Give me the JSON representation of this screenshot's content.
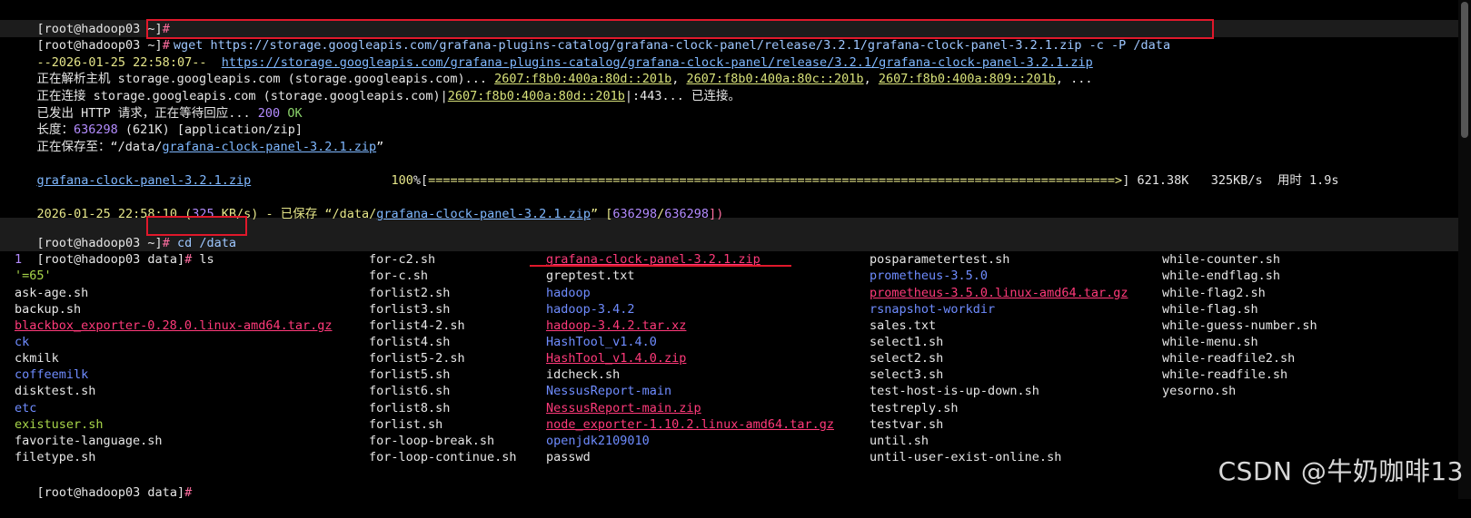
{
  "lines": {
    "l0": {
      "prompt": "[root@hadoop03 ~]",
      "hash": "#"
    },
    "l1": {
      "prompt": "[root@hadoop03 ~]",
      "hash": "#",
      "cmd": "wget https://storage.googleapis.com/grafana-plugins-catalog/grafana-clock-panel/release/3.2.1/grafana-clock-panel-3.2.1.zip -c -P /data"
    },
    "l2": {
      "ts": "--2026-01-25 22:58:07--",
      "url": "https://storage.googleapis.com/grafana-plugins-catalog/grafana-clock-panel/release/3.2.1/grafana-clock-panel-3.2.1.zip"
    },
    "l3": {
      "text1": "正在解析主机 storage.googleapis.com (storage.googleapis.com)... ",
      "ip1": "2607:f8b0:400a:80d::201b",
      "sep1": ", ",
      "ip2": "2607:f8b0:400a:80c::201b",
      "sep2": ", ",
      "ip3": "2607:f8b0:400a:809::201b",
      "tail": ", ..."
    },
    "l4": {
      "text1": "正在连接 storage.googleapis.com (storage.googleapis.com)|",
      "ip": "2607:f8b0:400a:80d::201b",
      "text2": "|:443... 已连接。"
    },
    "l5": {
      "text1": "已发出 HTTP 请求，正在等待回应... ",
      "code": "200",
      "ok": " OK"
    },
    "l6": {
      "label": "长度：",
      "len": "636298",
      "size": " (621K) ",
      "type": "[application/zip]"
    },
    "l7": {
      "label": "正在保存至：“/data/",
      "file": "grafana-clock-panel-3.2.1.zip",
      "end": "”"
    },
    "l9": {
      "file": "grafana-clock-panel-3.2.1.zip",
      "pct": "100",
      "pctsym": "%[",
      "bar": "=============================================================================================>",
      "close": "]",
      "stats": " 621.38K   325KB/s  用时 1.9s"
    },
    "l11": {
      "ts": "2026-01-25 22:58:10 (",
      "rate": "325",
      "rate2": " KB/s) - 已保存 “/data/",
      "file": "grafana-clock-panel-3.2.1.zip",
      "q": "” [",
      "n1": "636298",
      "slash": "/",
      "n2": "636298",
      "end": "])"
    },
    "l13": {
      "prompt": "[root@hadoop03 ~]",
      "hash": "#",
      "cmd": " cd /data"
    },
    "l14": {
      "prompt": "[root@hadoop03 data]",
      "hash": "#",
      "cmd": " ls"
    },
    "l26": {
      "prompt": "[root@hadoop03 data]",
      "hash": "#"
    }
  },
  "ls": {
    "col1": [
      {
        "name": "1",
        "kind": "num"
      },
      {
        "name": "'=65'",
        "kind": "exec"
      },
      {
        "name": "ask-age.sh",
        "kind": "plain"
      },
      {
        "name": "backup.sh",
        "kind": "plain"
      },
      {
        "name": "blackbox_exporter-0.28.0.linux-amd64.tar.gz",
        "kind": "zip"
      },
      {
        "name": "ck",
        "kind": "dir"
      },
      {
        "name": "ckmilk",
        "kind": "plain"
      },
      {
        "name": "coffeemilk",
        "kind": "dir"
      },
      {
        "name": "disktest.sh",
        "kind": "plain"
      },
      {
        "name": "etc",
        "kind": "dir"
      },
      {
        "name": "existuser.sh",
        "kind": "exec"
      },
      {
        "name": "favorite-language.sh",
        "kind": "plain"
      },
      {
        "name": "filetype.sh",
        "kind": "plain"
      }
    ],
    "col2": [
      {
        "name": "for-c2.sh",
        "kind": "plain"
      },
      {
        "name": "for-c.sh",
        "kind": "plain"
      },
      {
        "name": "forlist2.sh",
        "kind": "plain"
      },
      {
        "name": "forlist3.sh",
        "kind": "plain"
      },
      {
        "name": "forlist4-2.sh",
        "kind": "plain"
      },
      {
        "name": "forlist4.sh",
        "kind": "plain"
      },
      {
        "name": "forlist5-2.sh",
        "kind": "plain"
      },
      {
        "name": "forlist5.sh",
        "kind": "plain"
      },
      {
        "name": "forlist6.sh",
        "kind": "plain"
      },
      {
        "name": "forlist8.sh",
        "kind": "plain"
      },
      {
        "name": "forlist.sh",
        "kind": "plain"
      },
      {
        "name": "for-loop-break.sh",
        "kind": "plain"
      },
      {
        "name": "for-loop-continue.sh",
        "kind": "plain"
      }
    ],
    "col3": [
      {
        "name": "grafana-clock-panel-3.2.1.zip",
        "kind": "zip"
      },
      {
        "name": "greptest.txt",
        "kind": "plain"
      },
      {
        "name": "hadoop",
        "kind": "dir"
      },
      {
        "name": "hadoop-3.4.2",
        "kind": "dir"
      },
      {
        "name": "hadoop-3.4.2.tar.xz",
        "kind": "zip"
      },
      {
        "name": "HashTool_v1.4.0",
        "kind": "dir"
      },
      {
        "name": "HashTool_v1.4.0.zip",
        "kind": "zip"
      },
      {
        "name": "idcheck.sh",
        "kind": "plain"
      },
      {
        "name": "NessusReport-main",
        "kind": "dir"
      },
      {
        "name": "NessusReport-main.zip",
        "kind": "zip"
      },
      {
        "name": "node_exporter-1.10.2.linux-amd64.tar.gz",
        "kind": "zip"
      },
      {
        "name": "openjdk2109010",
        "kind": "dir"
      },
      {
        "name": "passwd",
        "kind": "plain"
      }
    ],
    "col4": [
      {
        "name": "posparametertest.sh",
        "kind": "plain"
      },
      {
        "name": "prometheus-3.5.0",
        "kind": "dir"
      },
      {
        "name": "prometheus-3.5.0.linux-amd64.tar.gz",
        "kind": "zip"
      },
      {
        "name": "rsnapshot-workdir",
        "kind": "dir"
      },
      {
        "name": "sales.txt",
        "kind": "plain"
      },
      {
        "name": "select1.sh",
        "kind": "plain"
      },
      {
        "name": "select2.sh",
        "kind": "plain"
      },
      {
        "name": "select3.sh",
        "kind": "plain"
      },
      {
        "name": "test-host-is-up-down.sh",
        "kind": "plain"
      },
      {
        "name": "testreply.sh",
        "kind": "plain"
      },
      {
        "name": "testvar.sh",
        "kind": "plain"
      },
      {
        "name": "until.sh",
        "kind": "plain"
      },
      {
        "name": "until-user-exist-online.sh",
        "kind": "plain"
      }
    ],
    "col5": [
      {
        "name": "while-counter.sh",
        "kind": "plain"
      },
      {
        "name": "while-endflag.sh",
        "kind": "plain"
      },
      {
        "name": "while-flag2.sh",
        "kind": "plain"
      },
      {
        "name": "while-flag.sh",
        "kind": "plain"
      },
      {
        "name": "while-guess-number.sh",
        "kind": "plain"
      },
      {
        "name": "while-menu.sh",
        "kind": "plain"
      },
      {
        "name": "while-readfile2.sh",
        "kind": "plain"
      },
      {
        "name": "while-readfile.sh",
        "kind": "plain"
      },
      {
        "name": "yesorno.sh",
        "kind": "plain"
      }
    ]
  },
  "watermark": "CSDN @牛奶咖啡13"
}
